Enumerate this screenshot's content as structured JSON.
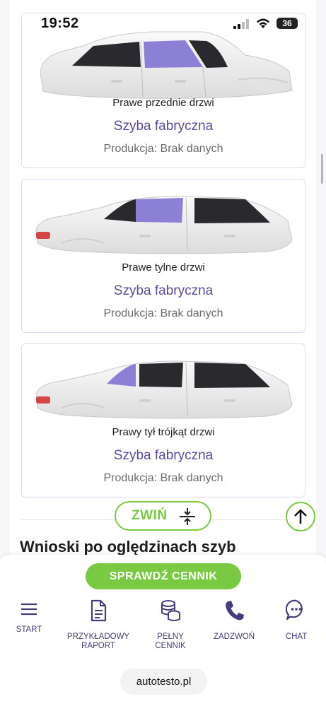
{
  "status_bar": {
    "time": "19:52",
    "battery": "36"
  },
  "glass_cards": [
    {
      "name": "Prawe przednie drzwi",
      "type": "Szyba fabryczna",
      "production": "Produkcja: Brak danych",
      "highlight": "front-right-door"
    },
    {
      "name": "Prawe tylne drzwi",
      "type": "Szyba fabryczna",
      "production": "Produkcja: Brak danych",
      "highlight": "rear-right-door"
    },
    {
      "name": "Prawy tył trójkąt drzwi",
      "type": "Szyba fabryczna",
      "production": "Produkcja: Brak danych",
      "highlight": "rear-right-quarter"
    }
  ],
  "collapse_button": {
    "label": "ZWIŃ"
  },
  "section": {
    "title": "Wnioski po oględzinach szyb"
  },
  "cta": {
    "label": "SPRAWDŹ CENNIK"
  },
  "nav": {
    "start": {
      "label_1": "START",
      "icon": "hamburger-icon"
    },
    "sample_report": {
      "label_1": "PRZYKŁADOWY",
      "label_2": "RAPORT",
      "icon": "document-icon"
    },
    "full_price": {
      "label_1": "PEŁNY",
      "label_2": "CENNIK",
      "icon": "coins-icon"
    },
    "call": {
      "label_1": "ZADZWOŃ",
      "icon": "phone-icon"
    },
    "chat": {
      "label_1": "CHAT",
      "icon": "chat-icon"
    }
  },
  "url": "autotesto.pl",
  "colors": {
    "accent_green": "#7ac943",
    "accent_purple": "#5a4a9c",
    "glass_highlight": "#8b7fd6"
  }
}
